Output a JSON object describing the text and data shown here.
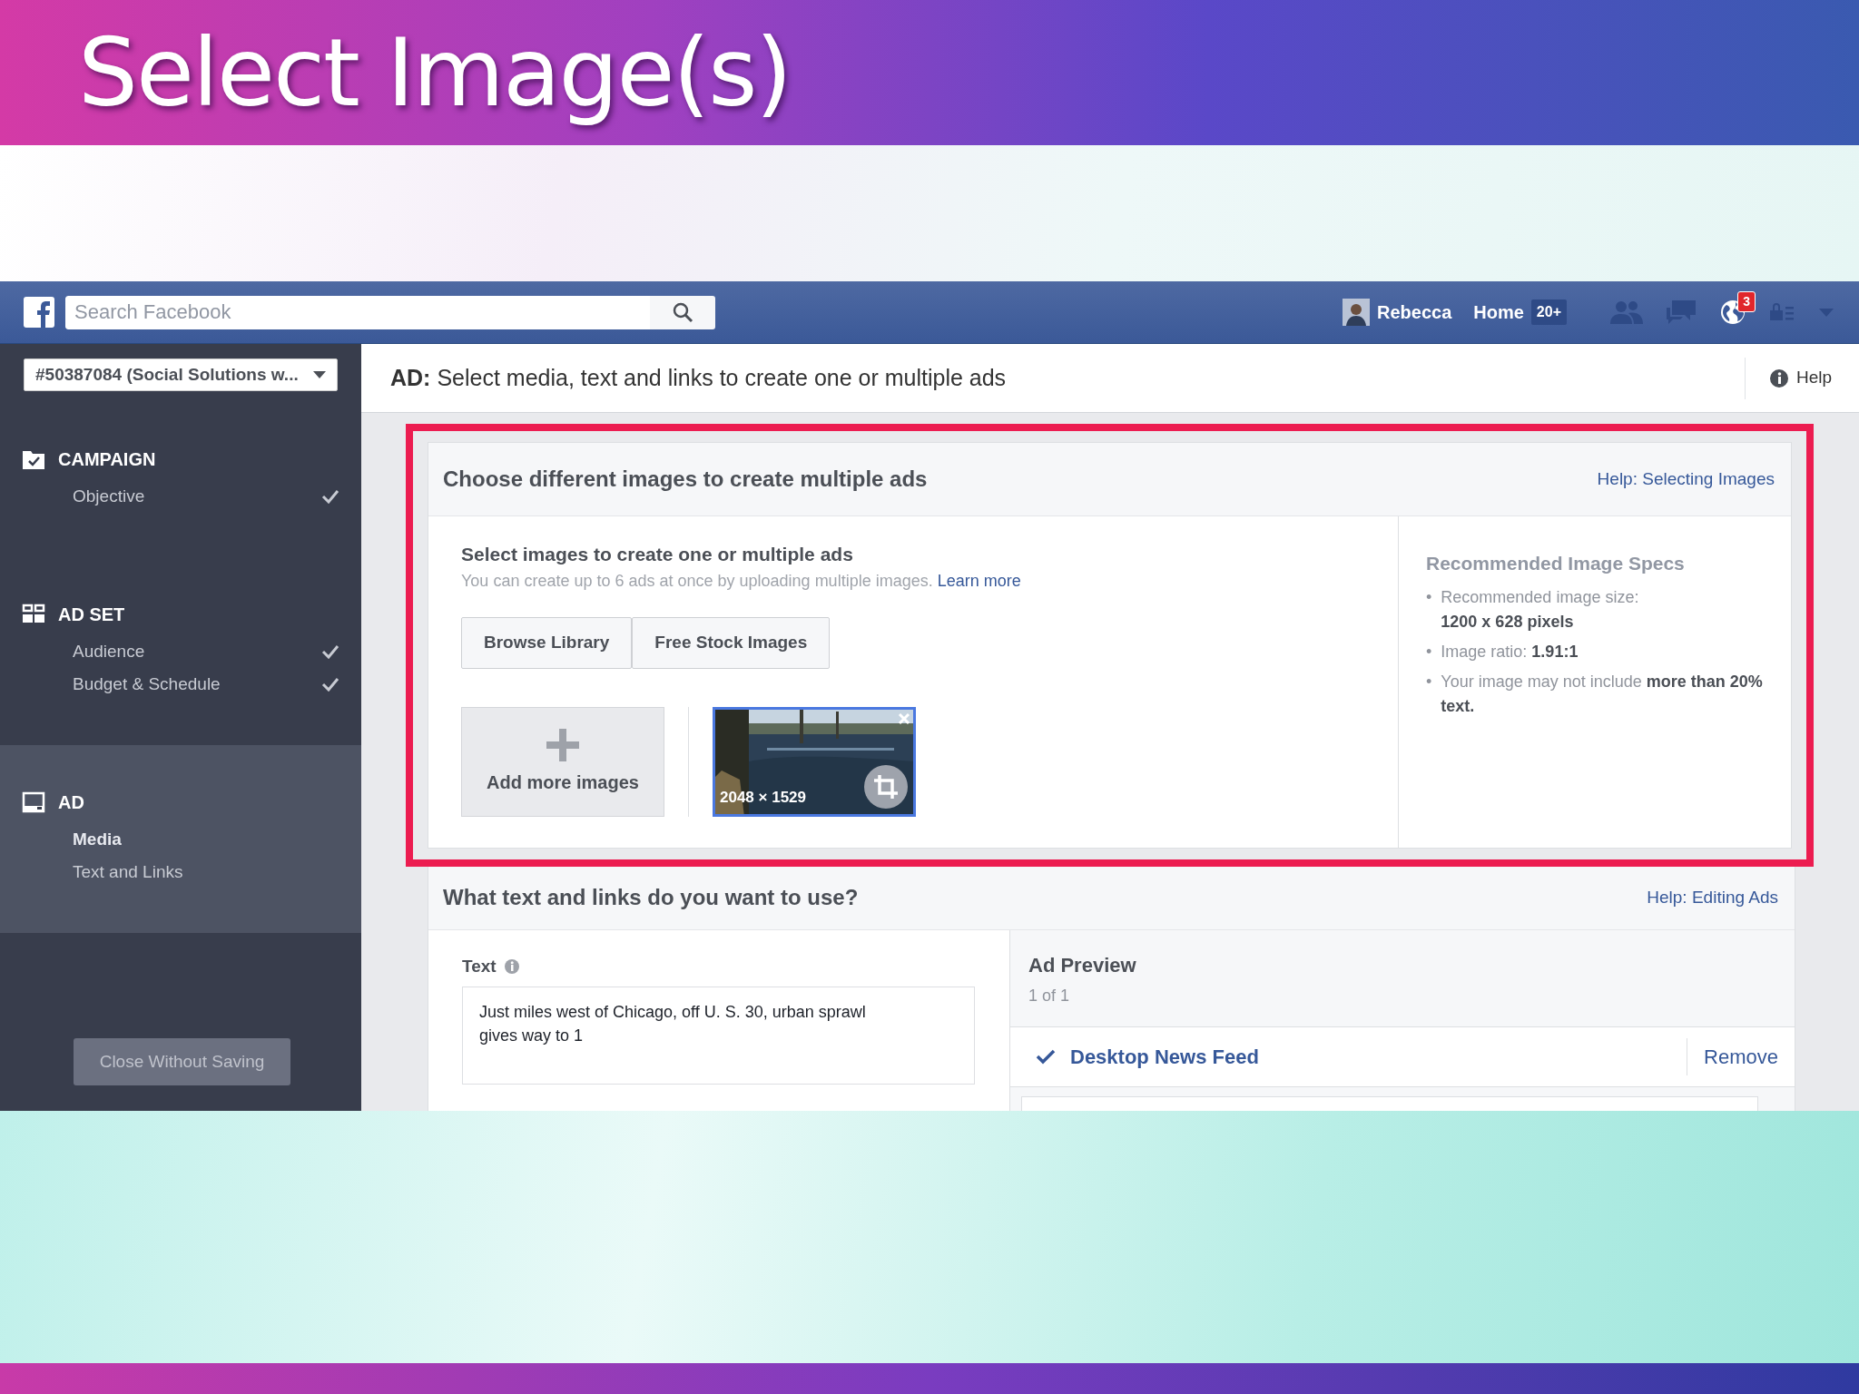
{
  "slide": {
    "title": "Select Image(s)"
  },
  "navbar": {
    "search_placeholder": "Search Facebook",
    "user": "Rebecca",
    "home": "Home",
    "home_badge": "20+",
    "notifications": "3"
  },
  "sidebar": {
    "account": "#50387084 (Social Solutions w...",
    "sections": [
      {
        "kind": "campaign",
        "title": "CAMPAIGN",
        "selected": false,
        "items": [
          {
            "label": "Objective",
            "selected": false,
            "checked": true
          }
        ]
      },
      {
        "kind": "adset",
        "title": "AD SET",
        "selected": false,
        "items": [
          {
            "label": "Audience",
            "selected": false,
            "checked": true
          },
          {
            "label": "Budget & Schedule",
            "selected": false,
            "checked": true
          }
        ]
      },
      {
        "kind": "ad",
        "title": "AD",
        "selected": true,
        "items": [
          {
            "label": "Media",
            "selected": true,
            "checked": false
          },
          {
            "label": "Text and Links",
            "selected": false,
            "checked": false
          }
        ]
      }
    ],
    "close_button": "Close Without Saving"
  },
  "header": {
    "prefix": "AD:",
    "text": "Select media, text and links to create one or multiple ads",
    "help": "Help"
  },
  "images_panel": {
    "title": "Choose different images to create multiple ads",
    "help_link": "Help: Selecting Images",
    "subtitle": "Select images to create one or multiple ads",
    "hint": "You can create up to 6 ads at once by uploading multiple images.",
    "learn_more": "Learn more",
    "buttons": [
      "Browse Library",
      "Free Stock Images"
    ],
    "add_more": "Add more images",
    "thumbnail": {
      "kind": "picture",
      "size": "2048 × 1529",
      "selected": true
    },
    "specs": {
      "title": "Recommended Image Specs",
      "marker": "•",
      "items": [
        "Recommended image size: **1200 x 628 pixels**",
        "Image ratio: **1.91:1**",
        "Your image may not include **more than 20% text.**"
      ]
    }
  },
  "text_panel": {
    "title": "What text and links do you want to use?",
    "help_link": "Help: Editing Ads",
    "text_label": "Text",
    "text_value": "Just miles west of Chicago, off U. S. 30, urban sprawl gives way to 1",
    "preview": {
      "title": "Ad Preview",
      "count": "1 of 1",
      "placement": {
        "label": "Desktop News Feed",
        "checked": true
      },
      "remove": "Remove"
    }
  }
}
